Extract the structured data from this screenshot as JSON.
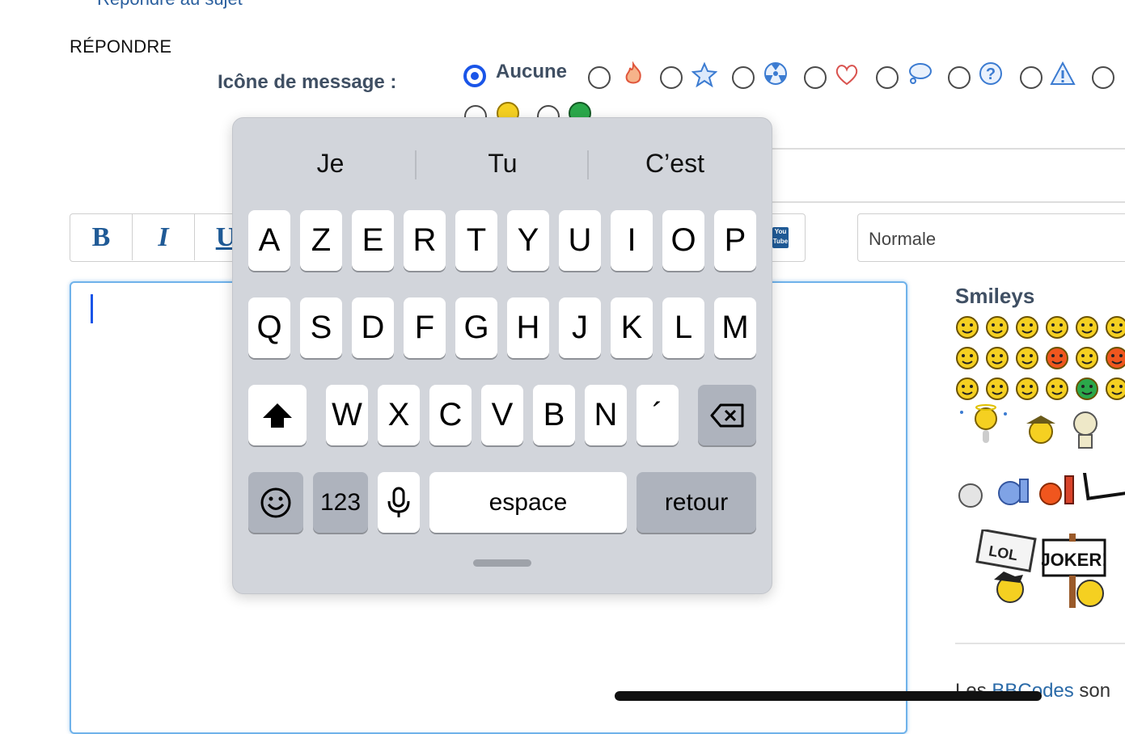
{
  "top_link": "Répondre au sujet",
  "section_title": "RÉPONDRE",
  "message_icon": {
    "label": "Icône de message :",
    "selected_label": "Aucune",
    "icons": [
      "flame-icon",
      "star-icon",
      "radioactive-icon",
      "heart-icon",
      "speech-bubble-icon",
      "question-icon",
      "warning-icon"
    ]
  },
  "toolbar": {
    "bold": "B",
    "italic": "I",
    "underline": "U",
    "youtube": "You Tube"
  },
  "font_size": {
    "value": "Normale"
  },
  "sidebar": {
    "smileys_title": "Smileys",
    "bbcodes_prefix": "Les ",
    "bbcodes_link": "BBCodes",
    "bbcodes_suffix": " son"
  },
  "keyboard": {
    "suggestions": [
      "Je",
      "Tu",
      "C’est"
    ],
    "row1": [
      "A",
      "Z",
      "E",
      "R",
      "T",
      "Y",
      "U",
      "I",
      "O",
      "P"
    ],
    "row2": [
      "Q",
      "S",
      "D",
      "F",
      "G",
      "H",
      "J",
      "K",
      "L",
      "M"
    ],
    "row3": [
      "W",
      "X",
      "C",
      "V",
      "B",
      "N",
      "´"
    ],
    "numbers_key": "123",
    "space_key": "espace",
    "return_key": "retour"
  },
  "colors": {
    "accent": "#1a55e8",
    "link": "#2a6aa8",
    "label": "#3f4f63",
    "keyboard_bg": "#d2d5db"
  }
}
